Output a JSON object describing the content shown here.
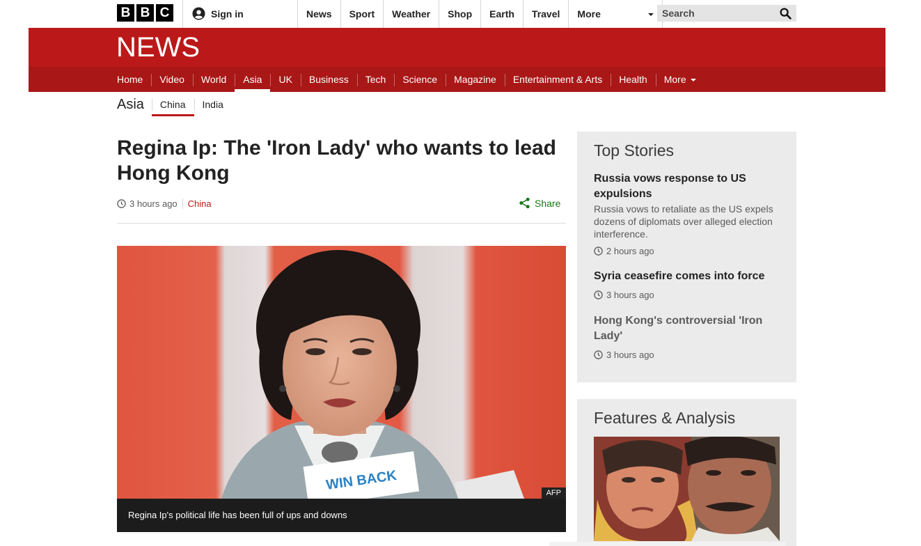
{
  "brand": {
    "logo_letters": [
      "B",
      "B",
      "C"
    ],
    "news_logo": "NEWS"
  },
  "topbar": {
    "signin_label": "Sign in",
    "nav": [
      "News",
      "Sport",
      "Weather",
      "Shop",
      "Earth",
      "Travel"
    ],
    "more_label": "More",
    "search_placeholder": "Search"
  },
  "section_nav": {
    "items": [
      "Home",
      "Video",
      "World",
      "Asia",
      "UK",
      "Business",
      "Tech",
      "Science",
      "Magazine",
      "Entertainment & Arts",
      "Health"
    ],
    "active": "Asia",
    "more_label": "More"
  },
  "sub_nav": {
    "section_title": "Asia",
    "items": [
      "China",
      "India"
    ],
    "active": "China"
  },
  "article": {
    "headline": "Regina Ip: The 'Iron Lady' who wants to lead Hong Kong",
    "time": "3 hours ago",
    "tag": "China",
    "share_label": "Share",
    "image_credit": "AFP",
    "image_caption": "Regina Ip's political life has been full of ups and downs",
    "podium_sign": "WIN BACK"
  },
  "top_stories": {
    "title": "Top Stories",
    "stories": [
      {
        "title": "Russia vows response to US expulsions",
        "summary": "Russia vows to retaliate as the US expels dozens of diplomats over alleged election interference.",
        "time": "2 hours ago"
      },
      {
        "title": "Syria ceasefire comes into force",
        "time": "3 hours ago"
      },
      {
        "title": "Hong Kong's controversial 'Iron Lady'",
        "time": "3 hours ago"
      }
    ]
  },
  "features": {
    "title": "Features & Analysis"
  },
  "colors": {
    "bbc_red": "#bb1919",
    "nav_red": "#a91717",
    "share_green": "#197619",
    "panel_grey": "#ebebeb"
  }
}
